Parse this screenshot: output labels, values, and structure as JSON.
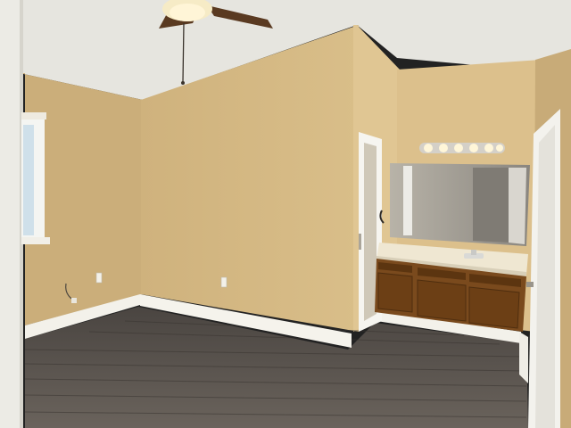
{
  "scene": {
    "colors": {
      "wall_main": "#d6bb86",
      "wall_left": "#cdb07c",
      "wall_right": "#c9ad79",
      "wall_lit": "#e2c995",
      "ceiling": "#e9e8e2",
      "floor": "#5b5550",
      "floor_dark": "#3f3a36",
      "baseboard": "#f3f1ea",
      "cabinet": "#7a4a1d",
      "cabinet_dark": "#5a3410",
      "countertop": "#efe6cf",
      "mirror": "#9a968e",
      "door_trim": "#f5f4ef",
      "fan_blade": "#5b3a22",
      "light_globe": "#fff3cf"
    },
    "icons": [
      "ceiling-fan-icon",
      "vanity-light-bar-icon",
      "window-icon",
      "faucet-icon",
      "outlet-icon"
    ]
  }
}
